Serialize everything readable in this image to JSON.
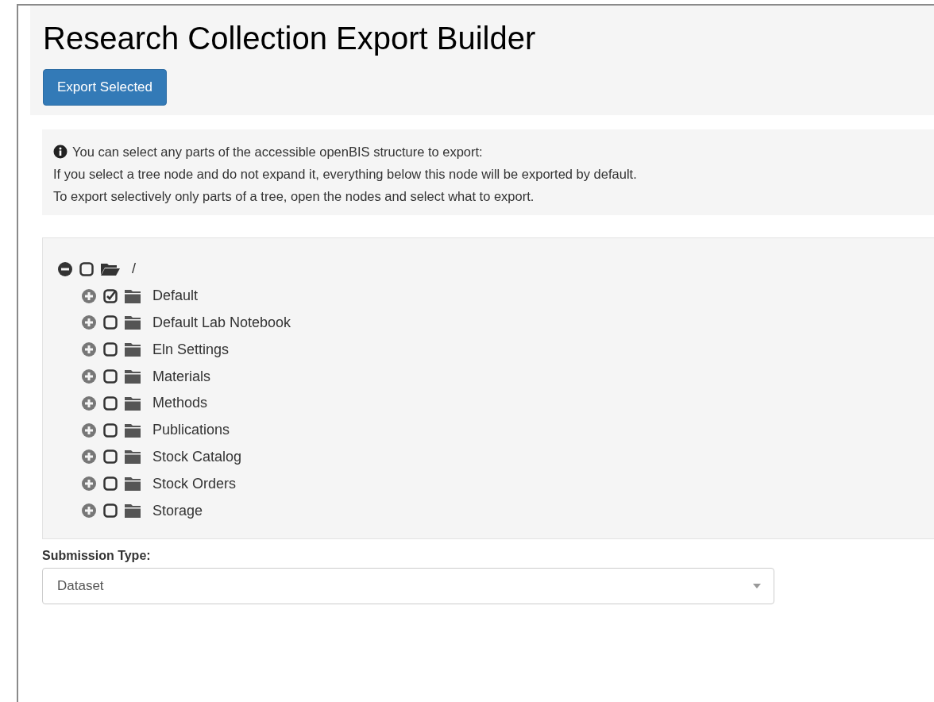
{
  "title": "Research Collection Export Builder",
  "export_button": "Export Selected",
  "info": {
    "lines": [
      "You can select any parts of the accessible openBIS structure to export:",
      "If you select a tree node and do not expand it, everything below this node will be exported by default.",
      "To export selectively only parts of a tree, open the nodes and select what to export."
    ]
  },
  "tree": [
    {
      "label": "/",
      "expanded": true,
      "checked": false,
      "children": [
        {
          "label": "Default",
          "expanded": false,
          "checked": true
        },
        {
          "label": "Default Lab Notebook",
          "expanded": false,
          "checked": false
        },
        {
          "label": "Eln Settings",
          "expanded": false,
          "checked": false
        },
        {
          "label": "Materials",
          "expanded": false,
          "checked": false
        },
        {
          "label": "Methods",
          "expanded": false,
          "checked": false
        },
        {
          "label": "Publications",
          "expanded": false,
          "checked": false
        },
        {
          "label": "Stock Catalog",
          "expanded": false,
          "checked": false
        },
        {
          "label": "Stock Orders",
          "expanded": false,
          "checked": false
        },
        {
          "label": "Storage",
          "expanded": false,
          "checked": false
        }
      ]
    }
  ],
  "submission_type": {
    "label": "Submission Type:",
    "value": "Dataset"
  }
}
